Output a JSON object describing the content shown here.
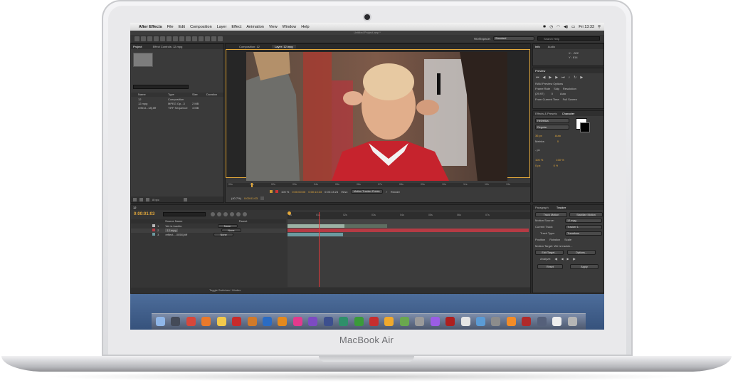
{
  "device": {
    "brand_label": "MacBook Air"
  },
  "menubar": {
    "apple": "",
    "app": "After Effects",
    "items": [
      "File",
      "Edit",
      "Composition",
      "Layer",
      "Effect",
      "Animation",
      "View",
      "Window",
      "Help"
    ],
    "clock": "Fri 13:33"
  },
  "window": {
    "title": "Untitled Project.aep *"
  },
  "workspace": {
    "label": "Workspace:",
    "value": "Standard",
    "search": "Search Help"
  },
  "project_panel": {
    "tabs": [
      "Project",
      "Effect Controls: 12.mpg"
    ],
    "columns": [
      "Name",
      "Type",
      "Size",
      "Duration"
    ],
    "items": [
      {
        "name": "12",
        "type": "Composition",
        "size": "",
        "duration": ""
      },
      {
        "name": "12.mpg",
        "type": "MPEG Op...3",
        "size": "2 MB",
        "duration": ""
      },
      {
        "name": "reflect...18].tiff",
        "type": "TIFF Sequence",
        "size": "4 MB",
        "duration": ""
      }
    ],
    "bpc": "8 bpc"
  },
  "viewer": {
    "tabs": [
      "Composition: 12",
      "Layer: 12.mpg"
    ],
    "ruler": [
      "00s",
      "01s",
      "02s",
      "03s",
      "04s",
      "05s",
      "06s",
      "07s",
      "08s",
      "09s",
      "10s",
      "11s",
      "12s",
      "13s"
    ],
    "zoom": "100 %",
    "time_in": "0:00:00:00",
    "time_out": "0:00:13:23",
    "duration": "0:00:13:24",
    "view_label": "View:",
    "view_value": "Motion Tracker Points",
    "render_label": "Render",
    "res": "(40.7%)",
    "timecode": "0:00:01:03"
  },
  "info_panel": {
    "tabs": [
      "Info",
      "Audio"
    ],
    "x": "X : -322",
    "y": "Y : 814"
  },
  "preview_panel": {
    "title": "Preview",
    "ram": "RAM Preview Options",
    "frame_rate_label": "Frame Rate",
    "skip_label": "Skip",
    "resolution_label": "Resolution",
    "frame_rate": "(29.97)",
    "skip": "0",
    "resolution": "Auto",
    "from_current": "From Current Time",
    "full_screen": "Full Screen"
  },
  "character_panel": {
    "tabs": [
      "Effects & Presets",
      "Character"
    ],
    "font": "Helvetica",
    "style": "Regular",
    "size": "36 px",
    "leading": "Auto",
    "kerning": "Metrics",
    "tracking": "0",
    "stroke": "- px",
    "vscale": "100 %",
    "hscale": "100 %",
    "baseline": "0 px",
    "tsume": "0 %"
  },
  "timeline": {
    "tab": "12",
    "timecode": "0:00:01:03",
    "columns": [
      "Source Name",
      "Parent"
    ],
    "layers": [
      {
        "num": "1",
        "name": "We is trackin.",
        "parent": "None",
        "color": "#b8b8b8"
      },
      {
        "num": "2",
        "name": "12.mpg",
        "parent": "None",
        "color": "#b53b44"
      },
      {
        "num": "3",
        "name": "reflect....0058].tiff",
        "parent": "None",
        "color": "#6c9aa0"
      }
    ],
    "ruler": [
      "0s",
      "01s",
      "02s",
      "03s",
      "04s",
      "05s",
      "06s",
      "07s"
    ],
    "footer": "Toggle Switches / Modes",
    "playhead_fraction": 0.13
  },
  "tracker_panel": {
    "tabs": [
      "Paragraph",
      "Tracker"
    ],
    "track_motion": "Track Motion",
    "stabilize_motion": "Stabilize Motion",
    "motion_source_label": "Motion Source:",
    "motion_source": "12.mpg",
    "current_track_label": "Current Track:",
    "current_track": "Tracker 1",
    "track_type_label": "Track Type:",
    "track_type": "Transform",
    "position": "Position",
    "rotation": "Rotation",
    "scale": "Scale",
    "motion_target": "Motion Target: We is trackin...",
    "edit_target": "Edit Target...",
    "options": "Options...",
    "analyze": "Analyze:",
    "reset": "Reset",
    "apply": "Apply"
  },
  "dock": {
    "apps": [
      "finder-icon",
      "dashboard-icon",
      "chrome-icon",
      "firefox-icon",
      "cyberduck-icon",
      "acrobat-icon",
      "bridge-icon",
      "photoshop-icon",
      "illustrator-icon",
      "indesign-icon",
      "premiere-icon",
      "encore-icon",
      "soundbooth-icon",
      "dreamweaver-icon",
      "flash-icon",
      "fireworks-icon",
      "contribute-icon",
      "system-preferences-icon",
      "itunes-icon",
      "photo-booth-icon",
      "calendar-icon",
      "preview-icon",
      "settings-icon",
      "vlc-icon",
      "transmission-icon",
      "motion-icon",
      "textedit-icon",
      "trash-icon"
    ]
  },
  "colors": {
    "accent": "#e4a93b",
    "panel": "#3a3a3a",
    "dark": "#2b2b2b",
    "layer_red": "#b53b44",
    "layer_teal": "#6c9aa0"
  }
}
